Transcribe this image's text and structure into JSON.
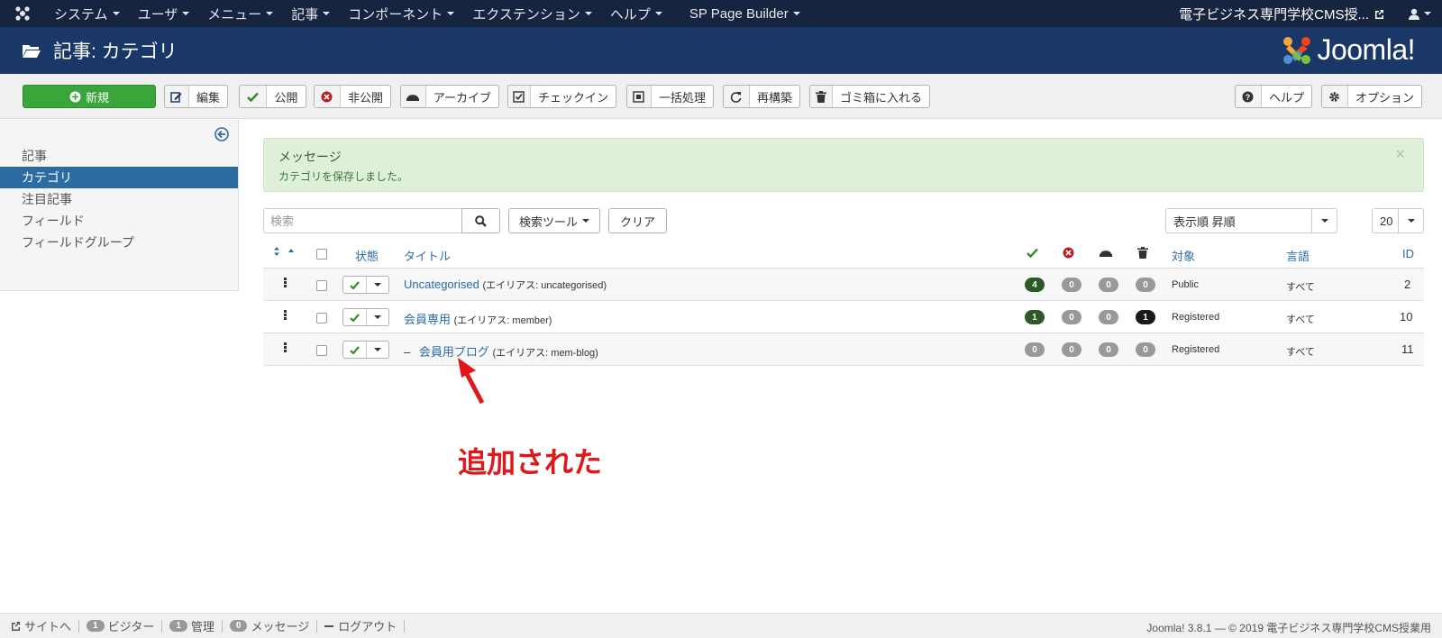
{
  "navbar": {
    "menus": [
      "システム",
      "ユーザ",
      "メニュー",
      "記事",
      "コンポーネント",
      "エクステンション",
      "ヘルプ",
      "SP Page Builder"
    ],
    "site_name": "電子ビジネス専門学校CMS授..."
  },
  "header": {
    "title": "記事: カテゴリ",
    "brand": "Joomla!"
  },
  "toolbar": {
    "new": "新規",
    "edit": "編集",
    "publish": "公開",
    "unpublish": "非公開",
    "archive": "アーカイブ",
    "checkin": "チェックイン",
    "batch": "一括処理",
    "rebuild": "再構築",
    "trash": "ゴミ箱に入れる",
    "help": "ヘルプ",
    "options": "オプション"
  },
  "sidebar": {
    "items": [
      {
        "label": "記事",
        "active": false
      },
      {
        "label": "カテゴリ",
        "active": true
      },
      {
        "label": "注目記事",
        "active": false
      },
      {
        "label": "フィールド",
        "active": false
      },
      {
        "label": "フィールドグループ",
        "active": false
      }
    ]
  },
  "message": {
    "heading": "メッセージ",
    "text": "カテゴリを保存しました。",
    "close": "×"
  },
  "filters": {
    "search_placeholder": "検索",
    "search_tools": "検索ツール",
    "clear": "クリア",
    "ordering": "表示順 昇順",
    "limit": "20"
  },
  "table": {
    "headers": {
      "status": "状態",
      "title": "タイトル",
      "access": "対象",
      "language": "言語",
      "id": "ID"
    },
    "rows": [
      {
        "prefix": "",
        "title": "Uncategorised",
        "alias": "(エイリアス: uncategorised)",
        "published": "4",
        "unpublished": "0",
        "archived": "0",
        "trashed": "0",
        "access": "Public",
        "language": "すべて",
        "id": "2"
      },
      {
        "prefix": "",
        "title": "会員専用",
        "alias": "(エイリアス: member)",
        "published": "1",
        "unpublished": "0",
        "archived": "0",
        "trashed": "1",
        "access": "Registered",
        "language": "すべて",
        "id": "10"
      },
      {
        "prefix": "–",
        "title": "会員用ブログ",
        "alias": "(エイリアス: mem-blog)",
        "published": "0",
        "unpublished": "0",
        "archived": "0",
        "trashed": "0",
        "access": "Registered",
        "language": "すべて",
        "id": "11"
      }
    ]
  },
  "annotation": {
    "text": "追加された",
    "color": "#e0181b"
  },
  "footer": {
    "view_site": "サイトへ",
    "visitors_count": "1",
    "visitors": "ビジター",
    "admins_count": "1",
    "admins": "管理",
    "messages_count": "0",
    "messages": "メッセージ",
    "logout": "ログアウト",
    "copyright": "Joomla! 3.8.1 — © 2019 電子ビジネス専門学校CMS授業用"
  },
  "colors": {
    "navbar": "#17243f",
    "header": "#1a3867",
    "new_button": "#3aa53a",
    "active_sidebar": "#2d6ca2",
    "link": "#2d6ca2"
  }
}
